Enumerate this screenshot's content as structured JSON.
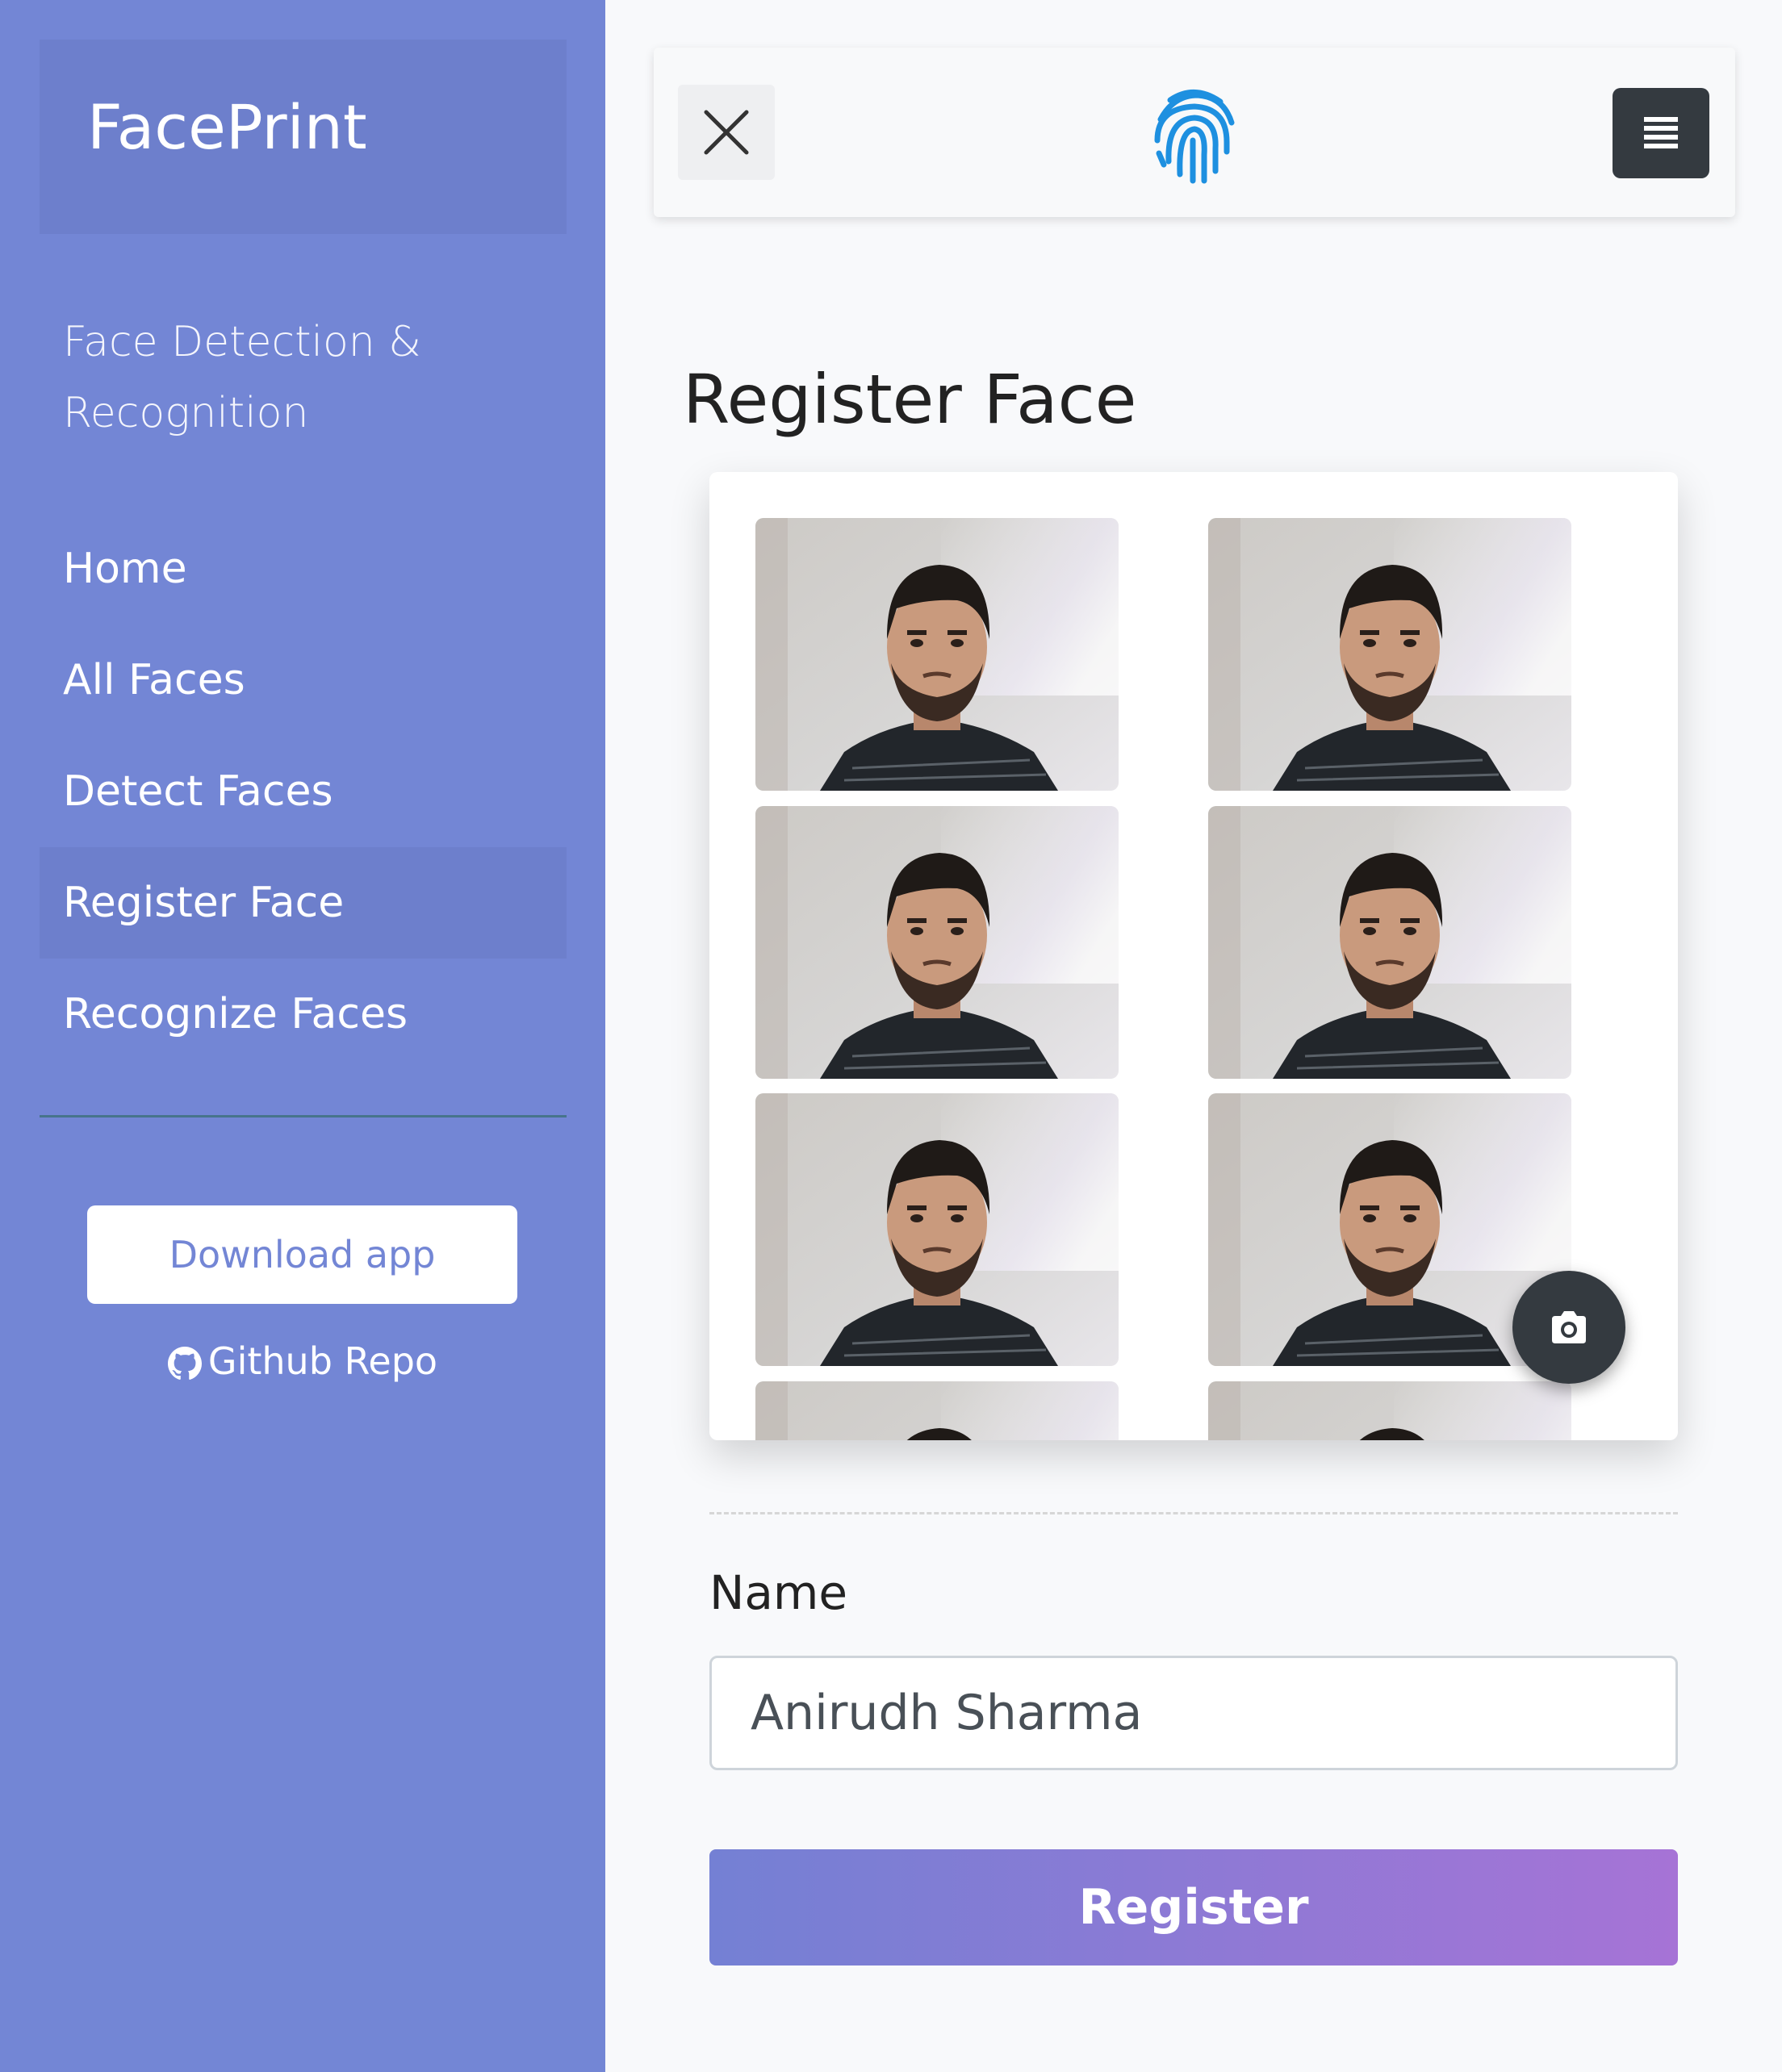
{
  "sidebar": {
    "brand": "FacePrint",
    "description": "Face Detection & Recognition",
    "items": [
      {
        "label": "Home"
      },
      {
        "label": "All Faces"
      },
      {
        "label": "Detect Faces"
      },
      {
        "label": "Register Face",
        "active": true
      },
      {
        "label": "Recognize Faces"
      }
    ],
    "download_label": "Download app",
    "github_label": "Github Repo"
  },
  "topbar": {
    "logo_icon": "fingerprint-icon",
    "close_icon": "close-icon",
    "menu_icon": "menu-icon"
  },
  "main": {
    "title": "Register Face",
    "captured_photos": 8,
    "camera_icon": "camera-icon",
    "name_label": "Name",
    "name_value": "Anirudh Sharma",
    "register_label": "Register"
  },
  "colors": {
    "sidebar": "#7386d5",
    "sidebar_active": "#6d7fcc",
    "dark_button": "#343a40",
    "register_gradient_start": "#7480d4",
    "register_gradient_end": "#a673d6"
  }
}
